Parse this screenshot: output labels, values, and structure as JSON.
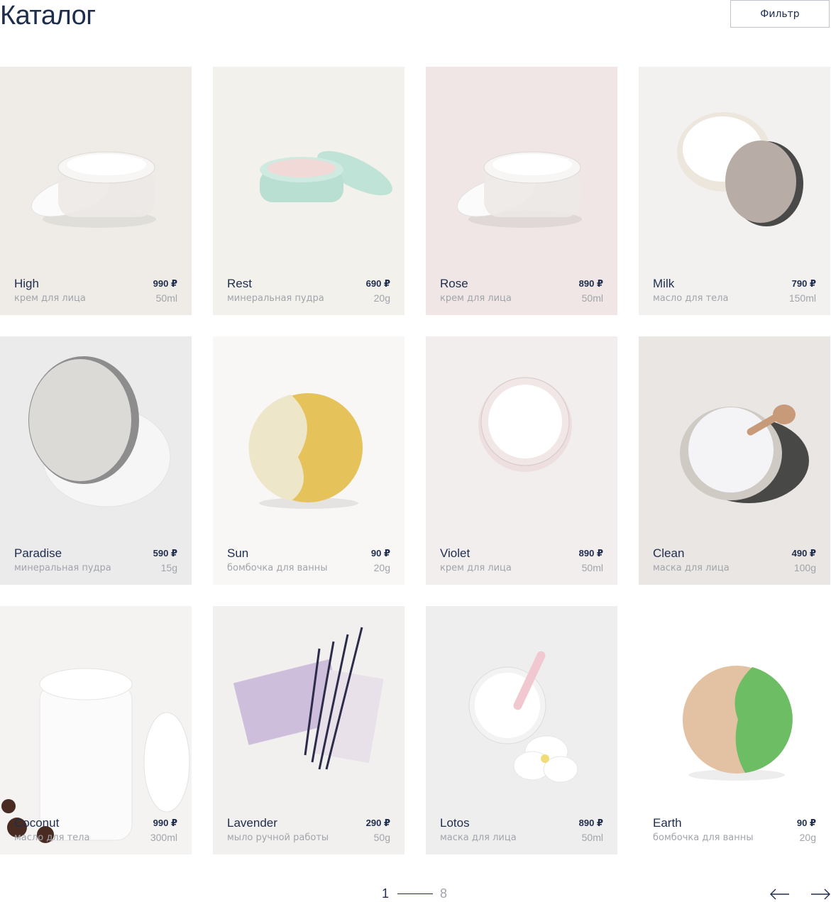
{
  "page": {
    "title": "Каталог",
    "filter_label": "Фильтр"
  },
  "currency": "₽",
  "products": [
    {
      "name": "High",
      "type": "крем для лица",
      "price": "990 ₽",
      "volume": "50ml",
      "art": "jar-clear",
      "bg": "#efece7"
    },
    {
      "name": "Rest",
      "type": "минеральная пудра",
      "price": "690 ₽",
      "volume": "20g",
      "art": "powder-mint",
      "bg": "#f3f1ec"
    },
    {
      "name": "Rose",
      "type": "крем для лица",
      "price": "890 ₽",
      "volume": "50ml",
      "art": "jar-clear",
      "bg": "#efe6e5"
    },
    {
      "name": "Milk",
      "type": "масло для тела",
      "price": "790 ₽",
      "volume": "150ml",
      "art": "jar-taupe",
      "bg": "#f2f1ef"
    },
    {
      "name": "Paradise",
      "type": "минеральная пудра",
      "price": "590 ₽",
      "volume": "15g",
      "art": "compact-silver",
      "bg": "#ebebeb"
    },
    {
      "name": "Sun",
      "type": "бомбочка для ванны",
      "price": "90 ₽",
      "volume": "20g",
      "art": "bomb-yellow",
      "bg": "#f8f7f6"
    },
    {
      "name": "Violet",
      "type": "крем для лица",
      "price": "890 ₽",
      "volume": "50ml",
      "art": "jar-top",
      "bg": "#f2eeee"
    },
    {
      "name": "Clean",
      "type": "маска для лица",
      "price": "490 ₽",
      "volume": "100g",
      "art": "clay-bowl",
      "bg": "#e9e6e3"
    },
    {
      "name": "Coconut",
      "type": "масло для тела",
      "price": "990 ₽",
      "volume": "300ml",
      "art": "tub-white",
      "bg": "#f4f3f1"
    },
    {
      "name": "Lavender",
      "type": "мыло ручной работы",
      "price": "290 ₽",
      "volume": "50g",
      "art": "soap-lavender",
      "bg": "#f1f0ee"
    },
    {
      "name": "Lotos",
      "type": "маска для лица",
      "price": "890 ₽",
      "volume": "50ml",
      "art": "mask-flower",
      "bg": "#eeeeee"
    },
    {
      "name": "Earth",
      "type": "бомбочка для ванны",
      "price": "90 ₽",
      "volume": "20g",
      "art": "bomb-green",
      "bg": "#ffffff"
    }
  ],
  "pagination": {
    "current": "1",
    "total": "8"
  },
  "icons": {
    "prev": "arrow-left-icon",
    "next": "arrow-right-icon"
  },
  "colors": {
    "text": "#1f2d4d",
    "muted": "#a1a4ab",
    "border": "#bfc3cc"
  }
}
